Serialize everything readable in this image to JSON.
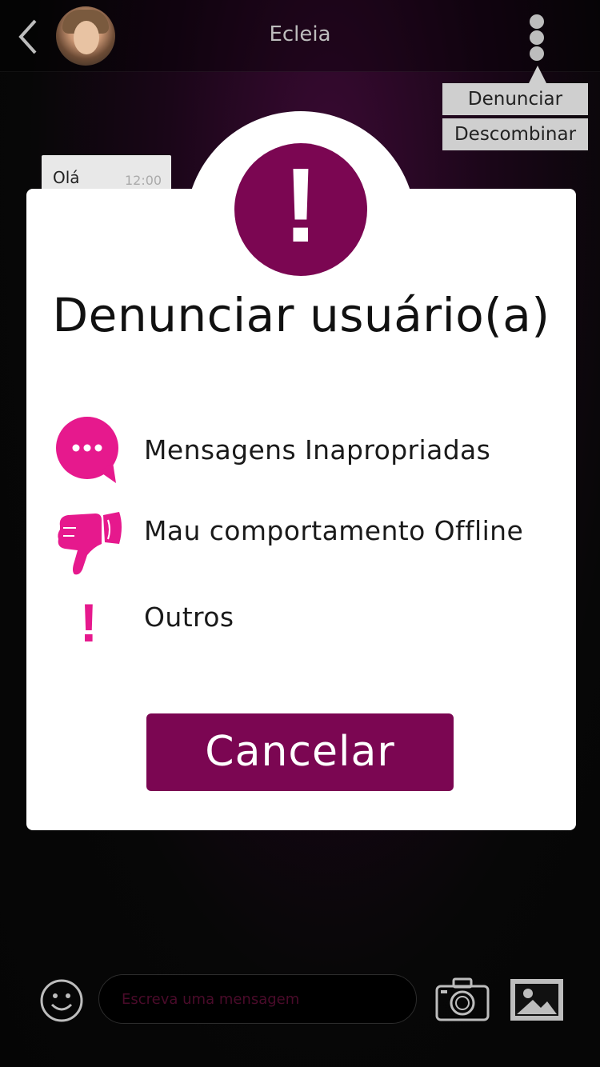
{
  "header": {
    "contact_name": "Ecleia",
    "back_icon": "chevron-left-icon",
    "more_icon": "vertical-dots-icon"
  },
  "menu": {
    "items": [
      {
        "label": "Denunciar"
      },
      {
        "label": "Descombinar"
      }
    ]
  },
  "chat": {
    "messages": [
      {
        "text": "Olá",
        "time": "12:00"
      }
    ]
  },
  "report_dialog": {
    "title": "Denunciar usuário(a)",
    "options": [
      {
        "label": "Mensagens Inapropriadas",
        "icon": "speech-bubble-icon"
      },
      {
        "label": "Mau comportamento Offline",
        "icon": "thumbs-down-icon"
      },
      {
        "label": "Outros",
        "icon": "exclamation-icon"
      }
    ],
    "cancel_label": "Cancelar",
    "alert_glyph": "!"
  },
  "composer": {
    "placeholder": "Escreva uma mensagem",
    "emoji_icon": "smiley-icon",
    "camera_icon": "camera-icon",
    "image_icon": "image-icon"
  },
  "colors": {
    "accent": "#7b0652",
    "icon_pink": "#e6198d",
    "menu_bg": "#cfcfcf"
  }
}
